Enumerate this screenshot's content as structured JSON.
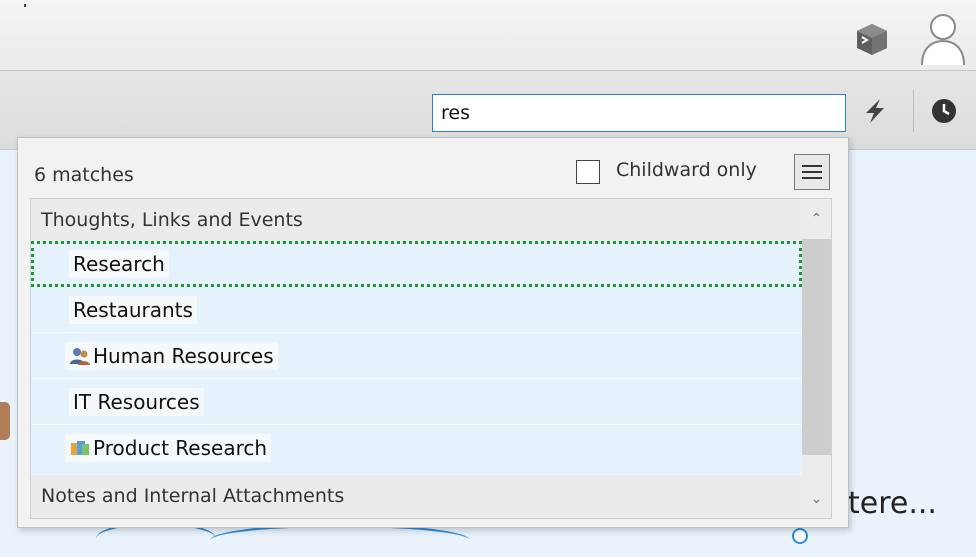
{
  "toolbar": {
    "search_value": "res",
    "icons": [
      "cube-icon",
      "user-icon",
      "bolt-icon",
      "clock-icon"
    ]
  },
  "dropdown": {
    "match_count": "6 matches",
    "childward_label": "Childward only",
    "childward_checked": false,
    "groups": [
      {
        "title": "Thoughts, Links and Events",
        "items": [
          {
            "label": "Research",
            "icon": "",
            "selected": true
          },
          {
            "label": "Restaurants",
            "icon": ""
          },
          {
            "label": "Human Resources",
            "icon": "people-icon"
          },
          {
            "label": "IT Resources",
            "icon": ""
          },
          {
            "label": "Product Research",
            "icon": "product-icon"
          }
        ]
      },
      {
        "title": "Notes and Internal Attachments",
        "items": []
      }
    ]
  },
  "background": {
    "partial_text": "tere..."
  },
  "colors": {
    "search_border": "#2b7fd6",
    "selection_outline": "#1a9a2f",
    "item_background": "#e6f2fb",
    "link_line": "#2e8fd8"
  }
}
